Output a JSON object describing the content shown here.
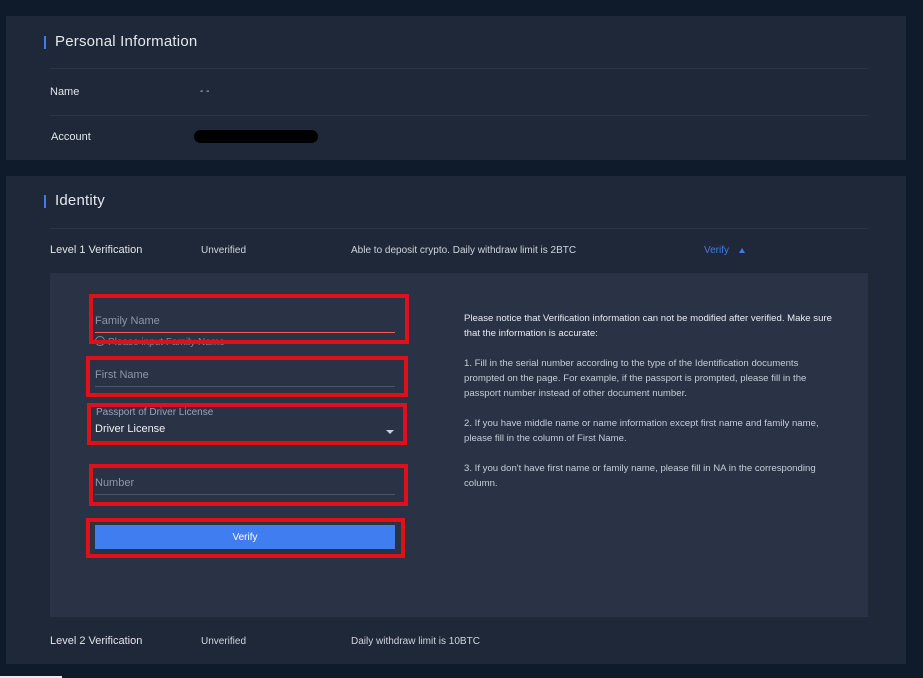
{
  "personal": {
    "title": "Personal Information",
    "name_label": "Name",
    "name_value": "- -",
    "account_label": "Account"
  },
  "identity": {
    "title": "Identity",
    "level1": {
      "label": "Level 1 Verification",
      "status": "Unverified",
      "description": "Able to deposit crypto. Daily withdraw limit is 2BTC",
      "action": "Verify"
    },
    "form": {
      "family_name_placeholder": "Family Name",
      "family_name_error": "Please input Family Name",
      "first_name_placeholder": "First Name",
      "doc_type_label": "Passport of Driver License",
      "doc_type_value": "Driver License",
      "number_placeholder": "Number",
      "submit_label": "Verify"
    },
    "notice": {
      "heading": "Please notice that Verification information can not be modified after verified. Make sure that the information is accurate:",
      "items": [
        "1.  Fill in the serial number according to the type of the Identification documents prompted on the page. For example, if the passport is prompted, please fill in the passport number instead of other document number.",
        "2.  If you have middle name or name information except first name and family name, please fill in the column of First Name.",
        "3.  If you don't have first name or family name, please fill in NA in the corresponding column."
      ]
    },
    "level2": {
      "label": "Level 2 Verification",
      "status": "Unverified",
      "description": "Daily withdraw limit is 10BTC"
    }
  },
  "colors": {
    "accent": "#3c7bf0",
    "error": "#ff5a5a",
    "highlight": "#e0101a",
    "panel": "#1f2838",
    "background": "#0f1a2b"
  },
  "icons": {
    "verify_toggle": "caret-up-icon",
    "select": "caret-down-icon",
    "error": "info-circle-icon"
  }
}
